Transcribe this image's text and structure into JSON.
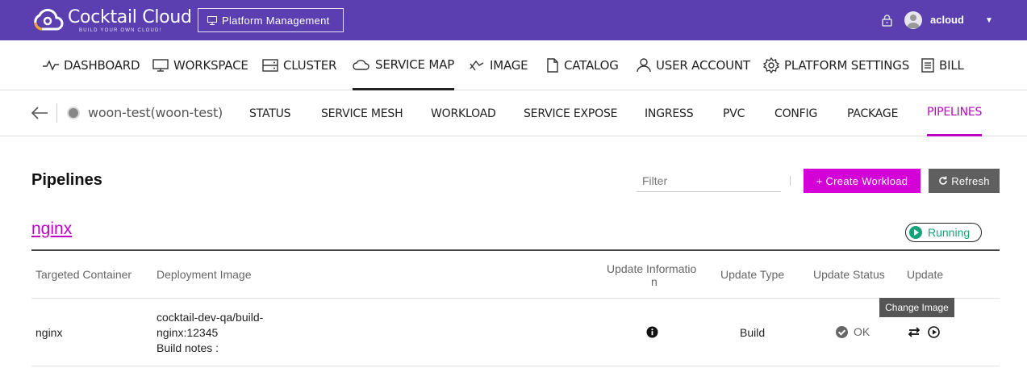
{
  "app": {
    "name": "Cocktail Cloud",
    "tagline": "BUILD YOUR OWN CLOUD!",
    "platform_button": "Platform Management",
    "user": "acloud",
    "user_caret": "▼"
  },
  "colors": {
    "topbar": "#5b3fb0",
    "accent": "#c000c8",
    "running": "#17a37a",
    "refresh": "#5f5f5f"
  },
  "main_nav": [
    {
      "label": "DASHBOARD",
      "icon": "pulse-icon"
    },
    {
      "label": "WORKSPACE",
      "icon": "monitor-icon"
    },
    {
      "label": "CLUSTER",
      "icon": "server-icon"
    },
    {
      "label": "SERVICE MAP",
      "icon": "cloud-icon",
      "active": true
    },
    {
      "label": "IMAGE",
      "icon": "image-icon"
    },
    {
      "label": "CATALOG",
      "icon": "document-icon"
    },
    {
      "label": "USER ACCOUNT",
      "icon": "user-icon"
    },
    {
      "label": "PLATFORM SETTINGS",
      "icon": "gear-icon"
    },
    {
      "label": "BILL",
      "icon": "bill-icon"
    }
  ],
  "sub_nav": {
    "namespace": "woon-test(woon-test)",
    "tabs": [
      "STATUS",
      "SERVICE MESH",
      "WORKLOAD",
      "SERVICE EXPOSE",
      "INGRESS",
      "PVC",
      "CONFIG",
      "PACKAGE",
      "PIPELINES"
    ],
    "active": "PIPELINES"
  },
  "content": {
    "title": "Pipelines",
    "filter_placeholder": "Filter",
    "create_button": "+ Create Workload",
    "refresh_button": "Refresh"
  },
  "pipeline": {
    "name": "nginx",
    "status": "Running",
    "columns": {
      "container": "Targeted Container",
      "image": "Deployment Image",
      "info_line1": "Update Informatio",
      "info_line2": "n",
      "type": "Update Type",
      "status": "Update Status",
      "update": "Update"
    },
    "rows": [
      {
        "container": "nginx",
        "image_line1": "cocktail-dev-qa/build-",
        "image_line2": "nginx:12345",
        "image_line3": "Build notes :",
        "type": "Build",
        "status": "OK"
      }
    ],
    "tooltip": "Change Image"
  }
}
